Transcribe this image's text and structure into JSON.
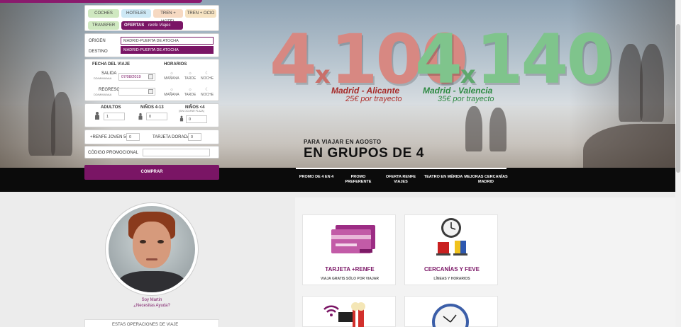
{
  "search": {
    "tabs": [
      "COCHES",
      "HOTELES",
      "TREN + HOTEL",
      "TREN + OCIO",
      "TRANSFER",
      "OFERTAS"
    ],
    "offers_brand": "renfe Viajes",
    "origin_label": "ORIGEN",
    "origin_value": "MADRID-PUERTA DE ATOCHA",
    "destination_label": "DESTINO",
    "suggestion": "MADRID-PUERTA DE ATOCHA",
    "date_label": "FECHA DEL VIAJE",
    "schedule_label": "HORARIOS",
    "departure_label": "SALIDA",
    "departure_format": "DD/MM/AAAA",
    "departure_value": "07/08/2019",
    "return_label": "REGRESO",
    "return_format": "DD/MM/AAAA",
    "return_value": "",
    "slots": [
      "MAÑANA",
      "TARDE",
      "NOCHE"
    ],
    "adults_label": "ADULTOS",
    "adults_value": "1",
    "kids_label": "NIÑOS 4-13",
    "kids_value": "0",
    "infants_label": "NIÑOS <4",
    "infants_sub": "(SIN OCUPAR PLAZA)",
    "infants_value": "0",
    "young_card_label": "+RENFE JOVEN 50",
    "young_card_value": "0",
    "gold_card_label": "TARJETA DORADA",
    "gold_card_value": "0",
    "promo_label": "CÓDIGO PROMOCIONAL",
    "promo_value": "",
    "buy_label": "COMPRAR"
  },
  "hero": {
    "offer1_big": "4",
    "offer1_x": "x",
    "offer1_rest": "100",
    "offer1_route": "Madrid - Alicante",
    "offer1_price": "25€ por trayecto",
    "offer2_big": "4",
    "offer2_x": "x",
    "offer2_rest": "140",
    "offer2_route": "Madrid - Valencia",
    "offer2_price": "35€ por trayecto",
    "subtitle": "PARA VIAJAR EN AGOSTO",
    "title": "EN GRUPOS DE 4"
  },
  "slider_tabs": [
    {
      "label": "PROMO DE 4 EN 4"
    },
    {
      "label": "PROMO PREFERENTE"
    },
    {
      "label": "OFERTA RENFE VIAJES"
    },
    {
      "label": "TEATRO EN MÉRIDA"
    },
    {
      "label": "MEJORAS CERCANÍAS MADRID"
    }
  ],
  "assistant": {
    "name": "Soy Martin",
    "question": "¿Necesitas Ayuda?",
    "strip_text": "ESTAS OPERACIONES DE VIAJE"
  },
  "tiles": [
    {
      "title": "TARJETA +RENFE",
      "subtitle": "VIAJA GRATIS SÓLO POR VIAJAR",
      "icon": "card-icon"
    },
    {
      "title": "CERCANÍAS Y FEVE",
      "subtitle": "LÍNEAS Y HORARIOS",
      "icon": "clock-chairs-icon"
    },
    {
      "title": "",
      "subtitle": "",
      "icon": "wifi-cinema-icon"
    },
    {
      "title": "",
      "subtitle": "",
      "icon": "clock-icon"
    }
  ],
  "colors": {
    "brand": "#7a1565",
    "coches": "#cfe8c0",
    "hoteles": "#cde8f5",
    "tren_hotel": "#f6d9c2",
    "tren_ocio": "#f6e3c2",
    "transfer": "#cfe8c0"
  }
}
